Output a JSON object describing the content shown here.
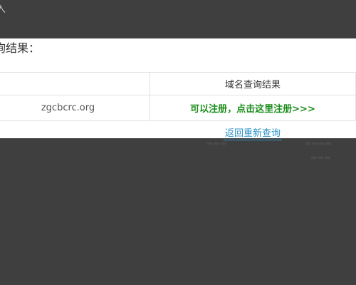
{
  "page": {
    "top_label": "入"
  },
  "panel": {
    "title": "询结果："
  },
  "table": {
    "header_left": "",
    "header_right": "域名查询结果",
    "domain": "zgcbcrc.org",
    "status": "可以注册，点击这里注册>>>"
  },
  "footer": {
    "back_link": "返回重新查询"
  }
}
